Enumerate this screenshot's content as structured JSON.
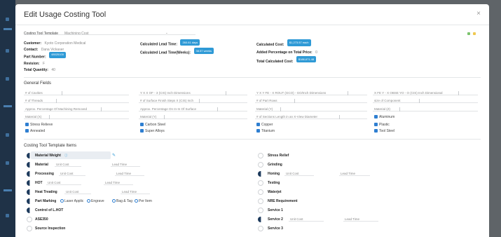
{
  "modal": {
    "title": "Edit Usage Costing Tool",
    "close_label": "×"
  },
  "template_row": {
    "label": "Costing Tool Template",
    "value": "Machining Cost"
  },
  "summary": {
    "left": [
      {
        "label": "Customer:",
        "value": "Kyoto Corporation Medical"
      },
      {
        "label": "Contact:",
        "value": "Dana Vickaser"
      },
      {
        "label": "Part Number:",
        "value": "",
        "badge": "48025100"
      },
      {
        "label": "Revision:",
        "value": "F"
      },
      {
        "label": "Total Quantity:",
        "value": "40"
      }
    ],
    "middle": [
      {
        "label": "Calculated Lead Time:",
        "badge": "260.61 days"
      },
      {
        "label": "Calculated Lead Time(Weeks):",
        "badge": "38.57 weeks"
      }
    ],
    "right": [
      {
        "label": "Calculated Cost:",
        "badge": "$1,273.57 each"
      },
      {
        "label": "Added Percentage on Total Price:",
        "value": "0"
      },
      {
        "label": "Total Calculated Cost:",
        "badge": "$188,671.48"
      }
    ]
  },
  "general_fields": {
    "title": "General Fields",
    "rows": [
      [
        "# of Cavities",
        "Y X X OF - 3 (CIS) Inch Dimensions",
        "Y X Y FE - X ROUT (GCO) - GO/Inch Dimensions",
        "X FE Y - X OBSE YO - O (CIS) Inch Dimensional"
      ],
      [
        "# of Threads",
        "# of Surface Finish Steps X (CIS) Inch",
        "# of Part Rows",
        "size of Component"
      ],
      [
        "Approx. Percentage Of Machining Removed",
        "Approx. Percentage On In-In Of Surface",
        "Material (Y)",
        "Material (Z)"
      ],
      [
        "Material (X)",
        "Material (Y)",
        "# of Sections Length in an X-View Diameter",
        "Aluminum"
      ]
    ],
    "checks": [
      [
        "Stress Relieve",
        "Carbon Steel",
        "Copper",
        "Plastic"
      ],
      [
        "Annealed",
        "Super Alloys",
        "Titanium",
        "Tool Steel"
      ]
    ]
  },
  "template_items": {
    "title": "Costing Tool Template Items",
    "left": [
      {
        "label": "Material Weight",
        "on": true,
        "unit_cost": "",
        "lead_time": ""
      },
      {
        "label": "Material",
        "on": true,
        "unit_cost": "Unit Cost",
        "lead_time": "Lead Time"
      },
      {
        "label": "Processing",
        "on": true,
        "unit_cost": "Unit Cost",
        "lead_time": "Lead Time"
      },
      {
        "label": "HOT",
        "on": true,
        "unit_cost": "Unit Cost",
        "lead_time": "Lead Time"
      },
      {
        "label": "Heat Treating",
        "on": true,
        "unit_cost": "Unit Cost",
        "lead_time": "Lead Time"
      },
      {
        "label": "Part Marking",
        "on": true,
        "radios": [
          "Laser Applic",
          "Engrave",
          "Bag & Tag",
          "Per Item"
        ]
      },
      {
        "label": "Control of L.HOT",
        "on": true
      },
      {
        "label": "ASE350",
        "on": false
      },
      {
        "label": "Source Inspection",
        "on": false
      }
    ],
    "right": [
      {
        "label": "Stress Relief",
        "on": false
      },
      {
        "label": "Grinding",
        "on": false
      },
      {
        "label": "Honing",
        "on": true,
        "unit_cost": "Unit Cost",
        "lead_time": "Lead Time"
      },
      {
        "label": "Testing",
        "on": false
      },
      {
        "label": "Waterjet",
        "on": false
      },
      {
        "label": "NRE Requirement",
        "on": false
      },
      {
        "label": "Service 1",
        "on": false
      },
      {
        "label": "Service 2",
        "on": true,
        "unit_cost": "Unit Cost",
        "lead_time": "Lead Time"
      },
      {
        "label": "Service 3",
        "on": false
      }
    ]
  },
  "colors": {
    "accent": "#2f9ad6",
    "toggle_on": "#1d3a5c",
    "checkbox": "#2f7fd1",
    "icon_green": "#7cc36e",
    "icon_yellow": "#f0c850"
  }
}
